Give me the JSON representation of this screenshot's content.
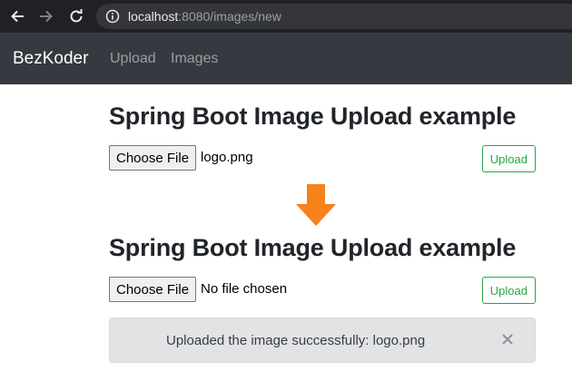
{
  "browser": {
    "url_host": "localhost",
    "url_rest": ":8080/images/new"
  },
  "navbar": {
    "brand": "BezKoder",
    "links": [
      "Upload",
      "Images"
    ]
  },
  "before": {
    "title": "Spring Boot Image Upload example",
    "choose_label": "Choose File",
    "file_name": "logo.png",
    "upload_label": "Upload"
  },
  "after": {
    "title": "Spring Boot Image Upload example",
    "choose_label": "Choose File",
    "file_name": "No file chosen",
    "upload_label": "Upload"
  },
  "alert": {
    "message": "Uploaded the image successfully: logo.png"
  },
  "colors": {
    "chrome_bg": "#202124",
    "navbar_bg": "#343a40",
    "success": "#28a745",
    "arrow": "#f7821b",
    "alert_bg": "#e2e3e5"
  },
  "icons": [
    "back-arrow-icon",
    "forward-arrow-icon",
    "reload-icon",
    "info-icon",
    "down-arrow-icon",
    "close-icon"
  ]
}
